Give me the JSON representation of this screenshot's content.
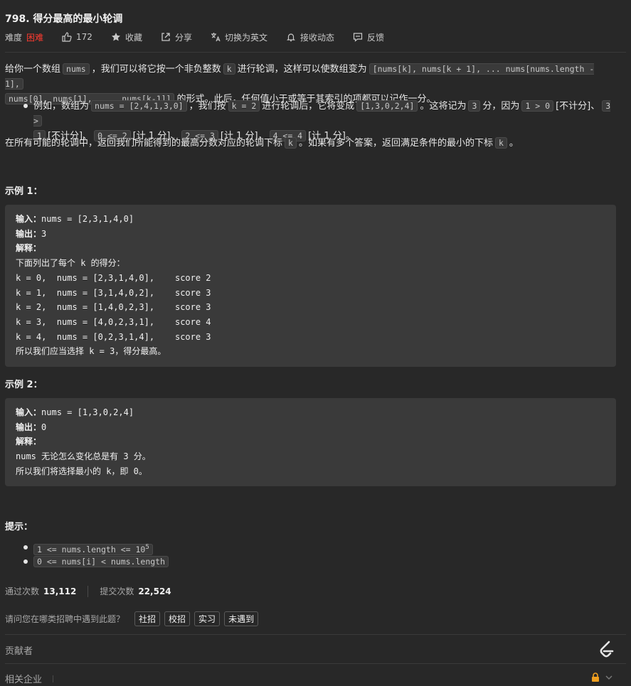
{
  "problem": {
    "title": "798. 得分最高的最小轮调"
  },
  "toolbar": {
    "difficulty_label": "难度",
    "difficulty_value": "困难",
    "likes": "172",
    "favorite": "收藏",
    "share": "分享",
    "switch_lang": "切换为英文",
    "notify": "接收动态",
    "feedback": "反馈"
  },
  "desc": {
    "p1_a": "给你一个数组",
    "c_nums": "nums",
    "p1_b": "，我们可以将它按一个非负整数",
    "c_k": "k",
    "p1_c": "进行轮调，这样可以使数组变为",
    "c_rot1": "[nums[k], nums[k + 1], ... nums[nums.length - 1],",
    "c_rot2": "nums[0], nums[1], ..., nums[k-1]]",
    "p1_d": "的形式。此后，任何值小于或等于其索引的项都可以记作一分。",
    "b_a": "例如，数组为",
    "c_ex": "nums = [2,4,1,3,0]",
    "b_b": "，我们按",
    "c_k2": "k = 2",
    "b_c": "进行轮调后，它将变成",
    "c_arr": "[1,3,0,2,4]",
    "b_d": "。这将记为",
    "c_3": "3",
    "b_e": "分，因为",
    "c_1g0": "1 > 0",
    "b_f": "[不计分]、",
    "c_3g": "3 >",
    "c_1": "1",
    "b_g": "[不计分]、",
    "c_0l2": "0 <= 2",
    "b_h": "[计 1 分]、",
    "c_2l3": "2 <= 3",
    "b_i": "[计 1 分]，",
    "c_4l4": "4 <= 4",
    "b_j": "[计 1 分]。",
    "p2_a": "在所有可能的轮调中，返回我们所能得到的最高分数对应的轮调下标",
    "c_k3": "k",
    "p2_b": "。如果有多个答案，返回满足条件的最小的下标",
    "c_k4": "k",
    "p2_c": "。"
  },
  "example1": {
    "heading": "示例 1：",
    "in_label": "输入：",
    "in_val": "nums = [2,3,1,4,0]",
    "out_label": "输出：",
    "out_val": "3",
    "exp_label": "解释：",
    "lines": [
      "下面列出了每个 k 的得分：",
      "k = 0,  nums = [2,3,1,4,0],    score 2",
      "k = 1,  nums = [3,1,4,0,2],    score 3",
      "k = 2,  nums = [1,4,0,2,3],    score 3",
      "k = 3,  nums = [4,0,2,3,1],    score 4",
      "k = 4,  nums = [0,2,3,1,4],    score 3",
      "所以我们应当选择 k = 3，得分最高。"
    ]
  },
  "example2": {
    "heading": "示例 2：",
    "in_label": "输入：",
    "in_val": "nums = [1,3,0,2,4]",
    "out_label": "输出：",
    "out_val": "0",
    "exp_label": "解释：",
    "lines": [
      "nums 无论怎么变化总是有 3 分。",
      "所以我们将选择最小的 k，即 0。"
    ]
  },
  "hints": {
    "heading": "提示：",
    "h1_a": "1 <= nums.length <= 10",
    "h1_sup": "5",
    "h2": "0 <= nums[i] < nums.length"
  },
  "stats": {
    "accepted_label": "通过次数",
    "accepted_val": "13,112",
    "submit_label": "提交次数",
    "submit_val": "22,524"
  },
  "recruit": {
    "question": "请问您在哪类招聘中遇到此题？",
    "tags": [
      "社招",
      "校招",
      "实习",
      "未遇到"
    ]
  },
  "footer": {
    "contributors": "贡献者",
    "companies": "相关企业"
  }
}
